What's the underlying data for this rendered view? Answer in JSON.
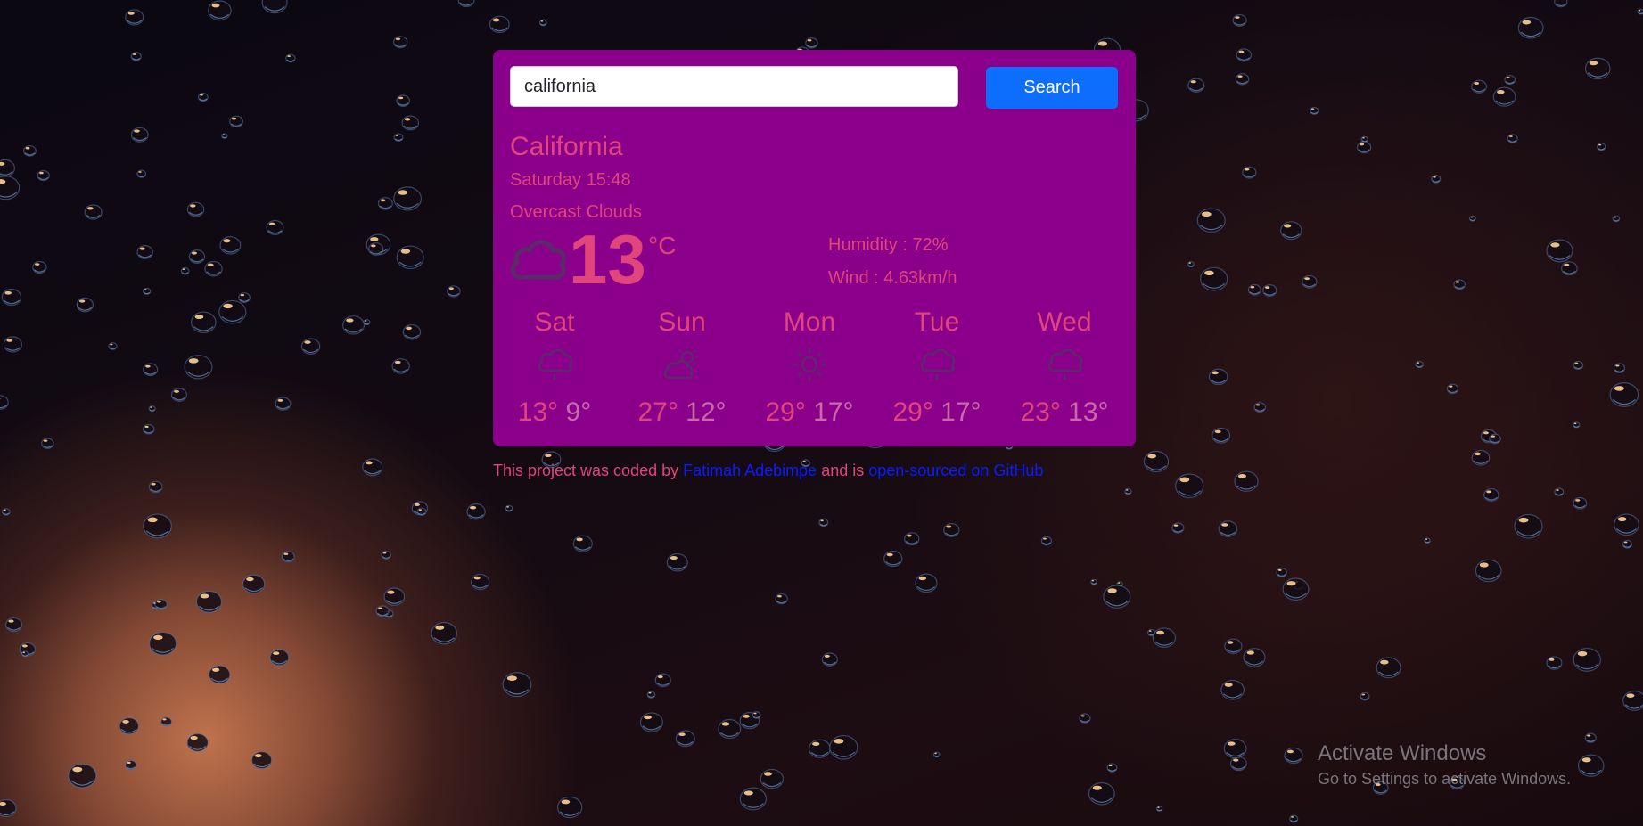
{
  "search": {
    "value": "california",
    "button_label": "Search"
  },
  "current": {
    "city": "California",
    "date": "Saturday 15:48",
    "description": "Overcast Clouds",
    "icon": "cloud-icon",
    "temperature": "13",
    "unit": "°C",
    "humidity": "Humidity : 72%",
    "wind": "Wind : 4.63km/h"
  },
  "forecast": [
    {
      "day": "Sat",
      "icon": "rain-cloud-icon",
      "max": "13°",
      "min": "9°"
    },
    {
      "day": "Sun",
      "icon": "partly-cloudy-icon",
      "max": "27°",
      "min": "12°"
    },
    {
      "day": "Mon",
      "icon": "sun-icon",
      "max": "29°",
      "min": "17°"
    },
    {
      "day": "Tue",
      "icon": "rain-cloud-icon",
      "max": "29°",
      "min": "17°"
    },
    {
      "day": "Wed",
      "icon": "rain-cloud-icon",
      "max": "23°",
      "min": "13°"
    }
  ],
  "footer": {
    "prefix": "This project was coded by ",
    "author": "Fatimah Adebimpe",
    "middle": " and is ",
    "repo_link": "open-sourced on GitHub"
  },
  "watermark": {
    "title": "Activate Windows",
    "subtitle": "Go to Settings to activate Windows."
  },
  "colors": {
    "card": "#8b008b",
    "accent_text": "#e0457b",
    "button": "#0d6efd",
    "link": "#0a1cff"
  }
}
